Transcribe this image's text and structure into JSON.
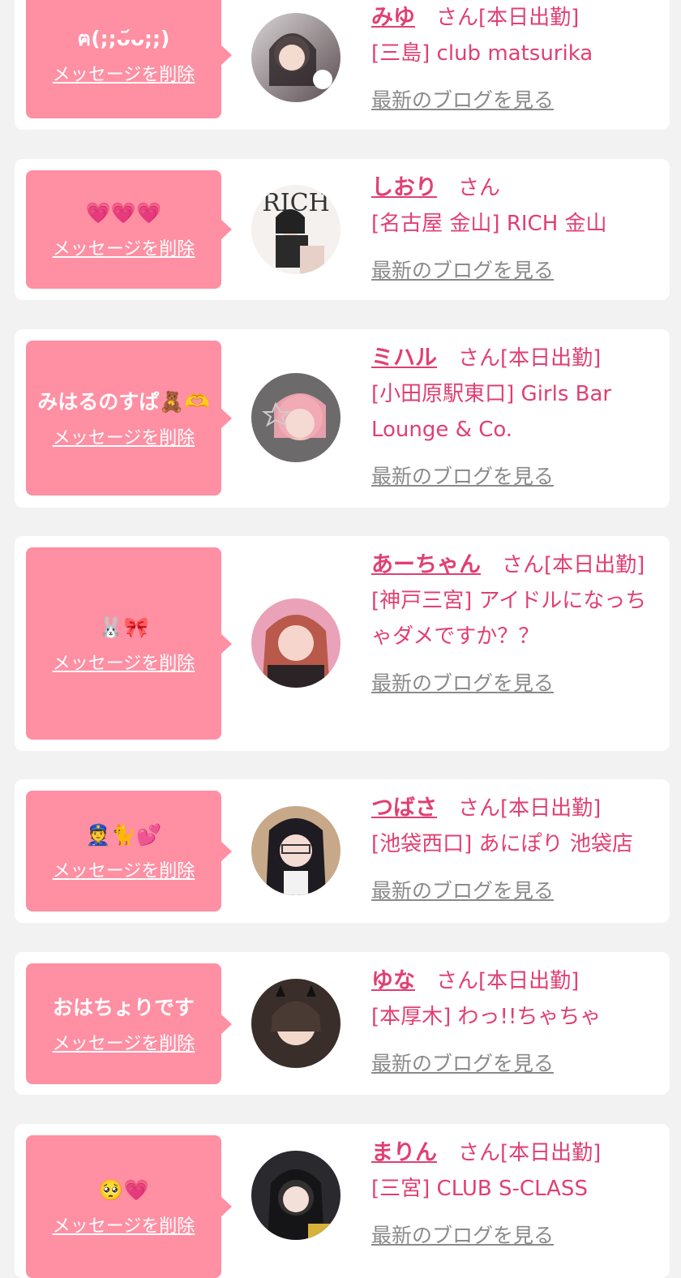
{
  "delete_label": "メッセージを削除",
  "blog_label": "最新のブログを見る",
  "san_label": "さん",
  "cards": [
    {
      "message": "ฅ(;;ᴗ᷄ᴗ;;)",
      "name": "みゆ",
      "status": "[本日出勤]",
      "shop": "[三島] club matsurika"
    },
    {
      "message": "💗💗💗",
      "name": "しおり",
      "status": "",
      "shop": "[名古屋 金山] RICH 金山"
    },
    {
      "message": "みはるのすぱ🧸🫶",
      "name": "ミハル",
      "status": "[本日出勤]",
      "shop": "[小田原駅東口] Girls Bar Lounge & Co."
    },
    {
      "message": "🐰🎀",
      "name": "あーちゃん",
      "status": "[本日出勤]",
      "shop": "[神戸三宮] アイドルになっちゃダメですか？？"
    },
    {
      "message": "👮🐈💕",
      "name": "つばさ",
      "status": "[本日出勤]",
      "shop": "[池袋西口] あにぽり 池袋店"
    },
    {
      "message": "おはちょりです",
      "name": "ゆな",
      "status": "[本日出勤]",
      "shop": "[本厚木] わっ!!ちゃちゃ"
    },
    {
      "message": "🥺💗",
      "name": "まりん",
      "status": "[本日出勤]",
      "shop": "[三宮] CLUB S-CLASS"
    }
  ],
  "colors": {
    "accent": "#e13f73",
    "bubble": "#ff8fa3",
    "background": "#f2f2f2"
  }
}
